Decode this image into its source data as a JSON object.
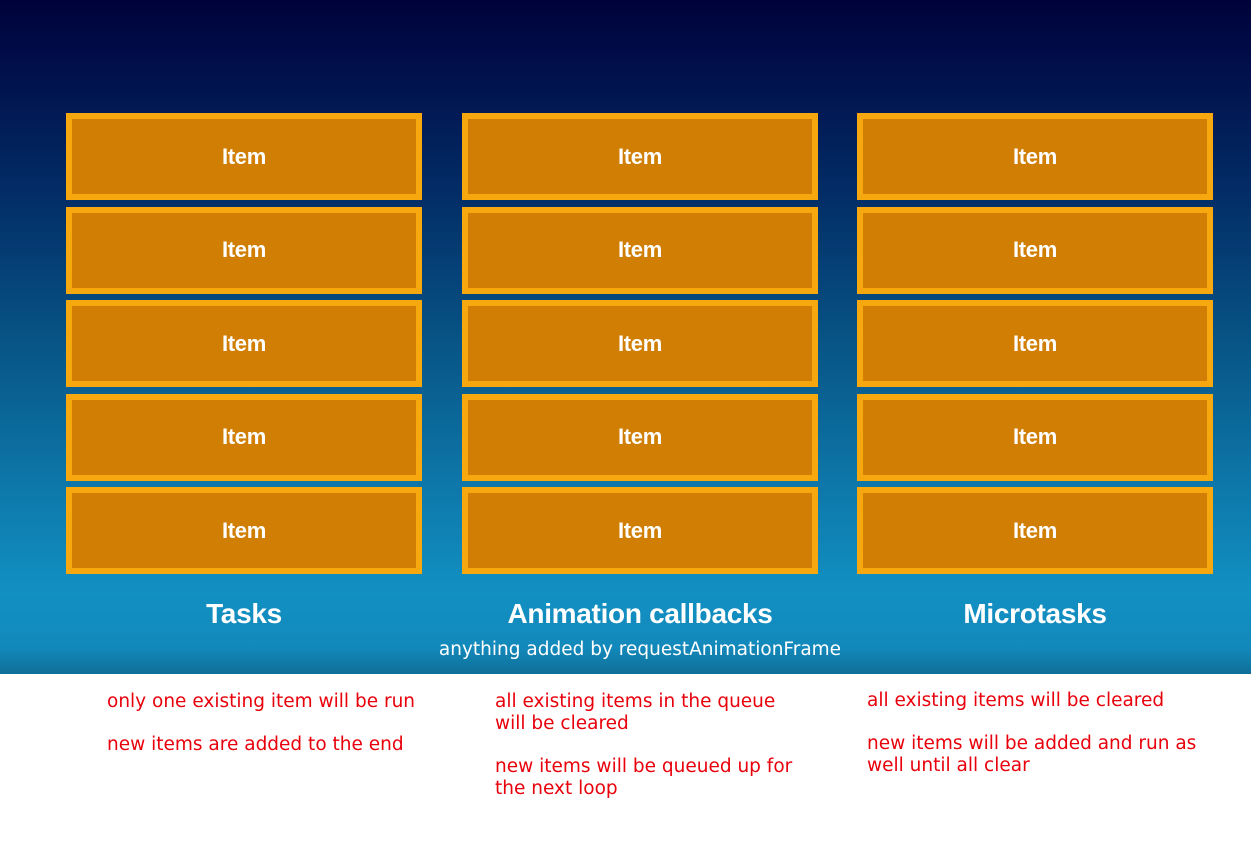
{
  "columns": [
    {
      "title": "Tasks",
      "items": [
        "Item",
        "Item",
        "Item",
        "Item",
        "Item"
      ],
      "notes": [
        "only one existing item will be run",
        "new items are added to the end"
      ]
    },
    {
      "title": "Animation callbacks",
      "subtitle": "anything added by requestAnimationFrame",
      "items": [
        "Item",
        "Item",
        "Item",
        "Item",
        "Item"
      ],
      "notes": [
        "all existing items in the queue will be cleared",
        "new items will be queued up for the next loop"
      ]
    },
    {
      "title": "Microtasks",
      "items": [
        "Item",
        "Item",
        "Item",
        "Item",
        "Item"
      ],
      "notes": [
        "all existing items will be cleared",
        "new items will be added and run as well until all clear"
      ]
    }
  ],
  "colors": {
    "item_fill": "#d07f04",
    "item_border": "#f7a80f",
    "note_text": "#e8000b",
    "background_top": "#00023a",
    "background_bottom": "#1290c2"
  }
}
